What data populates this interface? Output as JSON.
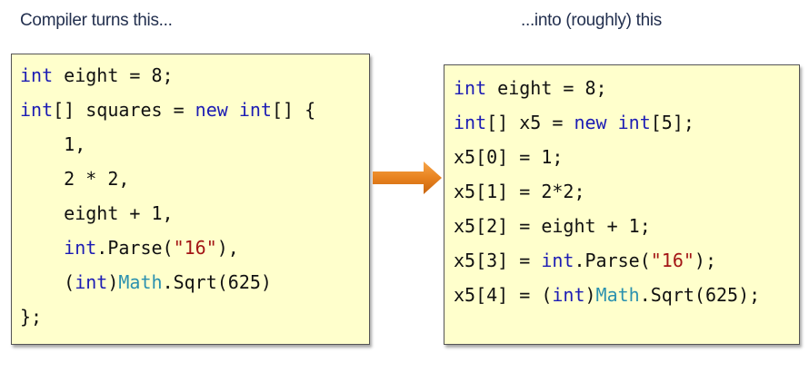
{
  "captions": {
    "left": "Compiler turns this...",
    "right": "...into (roughly) this"
  },
  "colors": {
    "keyword": "#1c1cb4",
    "type": "#2b91af",
    "string": "#a31515",
    "code_background": "#ffffcc",
    "arrow": "#e8821e"
  },
  "arrow_icon": "right-arrow-icon",
  "left_code": [
    [
      {
        "t": "int",
        "k": "kw"
      },
      {
        "t": " eight = 8;",
        "k": ""
      }
    ],
    [
      {
        "t": "int",
        "k": "kw"
      },
      {
        "t": "[] squares = ",
        "k": ""
      },
      {
        "t": "new",
        "k": "kw"
      },
      {
        "t": " ",
        "k": ""
      },
      {
        "t": "int",
        "k": "kw"
      },
      {
        "t": "[] {",
        "k": ""
      }
    ],
    [
      {
        "t": "    1,",
        "k": ""
      }
    ],
    [
      {
        "t": "    2 * 2,",
        "k": ""
      }
    ],
    [
      {
        "t": "    eight + 1,",
        "k": ""
      }
    ],
    [
      {
        "t": "    ",
        "k": ""
      },
      {
        "t": "int",
        "k": "kw"
      },
      {
        "t": ".Parse(",
        "k": ""
      },
      {
        "t": "\"16\"",
        "k": "str"
      },
      {
        "t": "),",
        "k": ""
      }
    ],
    [
      {
        "t": "    (",
        "k": ""
      },
      {
        "t": "int",
        "k": "kw"
      },
      {
        "t": ")",
        "k": ""
      },
      {
        "t": "Math",
        "k": "type"
      },
      {
        "t": ".Sqrt(625)",
        "k": ""
      }
    ],
    [
      {
        "t": "};",
        "k": ""
      }
    ]
  ],
  "right_code": [
    [
      {
        "t": "int",
        "k": "kw"
      },
      {
        "t": " eight = 8;",
        "k": ""
      }
    ],
    [
      {
        "t": "int",
        "k": "kw"
      },
      {
        "t": "[] x5 = ",
        "k": ""
      },
      {
        "t": "new",
        "k": "kw"
      },
      {
        "t": " ",
        "k": ""
      },
      {
        "t": "int",
        "k": "kw"
      },
      {
        "t": "[5];",
        "k": ""
      }
    ],
    [
      {
        "t": "x5[0] = 1;",
        "k": ""
      }
    ],
    [
      {
        "t": "x5[1] = 2*2;",
        "k": ""
      }
    ],
    [
      {
        "t": "x5[2] = eight + 1;",
        "k": ""
      }
    ],
    [
      {
        "t": "x5[3] = ",
        "k": ""
      },
      {
        "t": "int",
        "k": "kw"
      },
      {
        "t": ".Parse(",
        "k": ""
      },
      {
        "t": "\"16\"",
        "k": "str"
      },
      {
        "t": ");",
        "k": ""
      }
    ],
    [
      {
        "t": "x5[4] = (",
        "k": ""
      },
      {
        "t": "int",
        "k": "kw"
      },
      {
        "t": ")",
        "k": ""
      },
      {
        "t": "Math",
        "k": "type"
      },
      {
        "t": ".Sqrt(625);",
        "k": ""
      }
    ]
  ]
}
